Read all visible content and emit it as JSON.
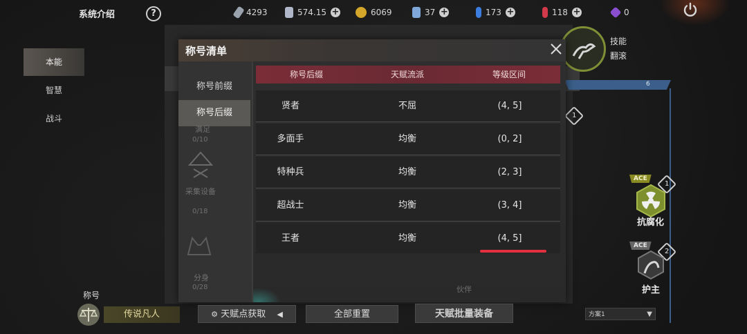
{
  "topbar": {
    "system_intro": "系统介绍",
    "help_icon": "?",
    "resources": [
      {
        "icon": "chip-icon",
        "value": "4293",
        "has_plus": false,
        "color": "#9aa3ad"
      },
      {
        "icon": "card-icon",
        "value": "574.15",
        "has_plus": true,
        "color": "#b0b7c8"
      },
      {
        "icon": "coin-icon",
        "value": "6069",
        "has_plus": false,
        "color": "#d4a62a"
      },
      {
        "icon": "crystal-icon",
        "value": "37",
        "has_plus": true,
        "color": "#7fa7d9"
      },
      {
        "icon": "blue-potion-icon",
        "value": "173",
        "has_plus": true,
        "color": "#3b7ee0"
      },
      {
        "icon": "red-potion-icon",
        "value": "118",
        "has_plus": true,
        "color": "#d23a4a"
      },
      {
        "icon": "purple-gem-icon",
        "value": "0",
        "has_plus": false,
        "color": "#8a4fd0"
      }
    ]
  },
  "leftnav": {
    "items": [
      {
        "label": "本能",
        "active": true
      },
      {
        "label": "智慧",
        "active": false
      },
      {
        "label": "战斗",
        "active": false
      }
    ]
  },
  "background": {
    "skill_labels": [
      "技能",
      "翻滚"
    ],
    "blue_bar_number": "6",
    "side_skills": [
      {
        "tag": "ACE",
        "level": "1",
        "label": "抗腐化"
      },
      {
        "tag": "ACE",
        "level": "2",
        "label": "护主"
      }
    ],
    "partial_badge": "1"
  },
  "dialog": {
    "title": "称号清单",
    "side_tabs": [
      {
        "label": "称号前缀",
        "active": false
      },
      {
        "label": "称号后缀",
        "active": true
      }
    ],
    "ghost_items": [
      {
        "name": "满足",
        "count": "0/10"
      },
      {
        "name": "采集设备",
        "count": "0/18"
      },
      {
        "name": "分身",
        "count": "0/28"
      }
    ],
    "table": {
      "headers": [
        "称号后缀",
        "天赋流派",
        "等级区间"
      ],
      "rows": [
        {
          "suffix": "贤者",
          "school": "不屈",
          "range": "(4, 5]"
        },
        {
          "suffix": "多面手",
          "school": "均衡",
          "range": "(0, 2]"
        },
        {
          "suffix": "特种兵",
          "school": "均衡",
          "range": "(2, 3]"
        },
        {
          "suffix": "超战士",
          "school": "均衡",
          "range": "(3, 4]"
        },
        {
          "suffix": "王者",
          "school": "均衡",
          "range": "(4, 5]"
        }
      ]
    },
    "ghost_bottom": "伙伴",
    "highlight_color": "#e33040"
  },
  "bottombar": {
    "title_label": "称号",
    "current_title": "传说凡人",
    "talent_source_button": "天赋点获取",
    "reset_all_button": "全部重置",
    "batch_equip_button": "天赋批量装备",
    "plan_dropdown": "方案1"
  }
}
